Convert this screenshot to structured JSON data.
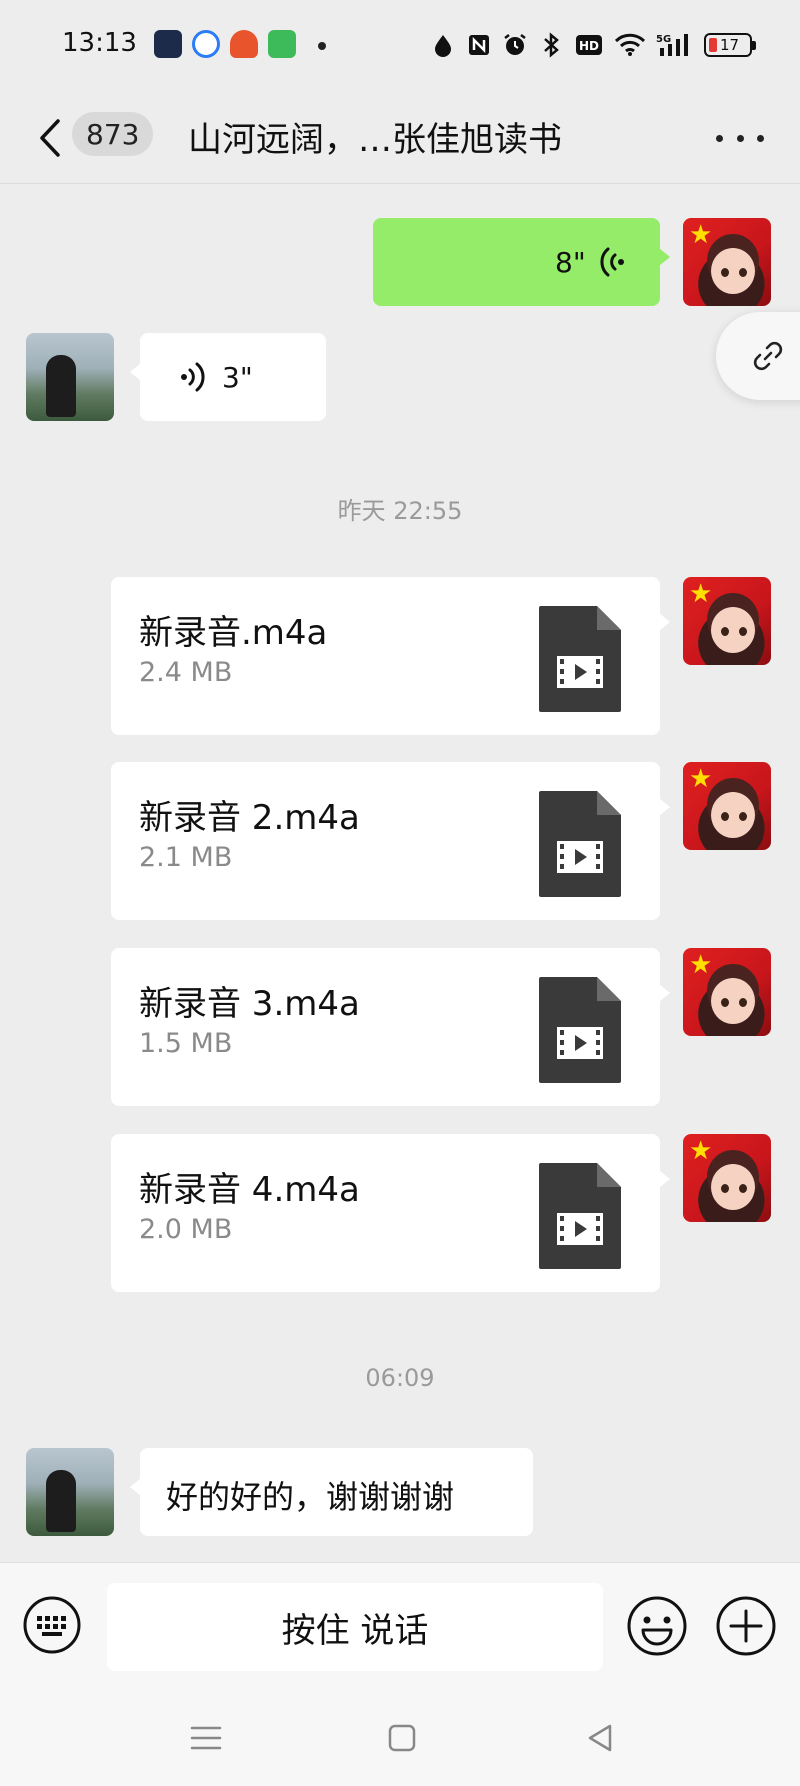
{
  "status_bar": {
    "time": "13:13",
    "battery_level": "17",
    "network": "5G",
    "hd": "HD"
  },
  "header": {
    "unread_count": "873",
    "title": "山河远阔，…张佳旭读书"
  },
  "messages": {
    "voice_sent": {
      "duration": "8\""
    },
    "voice_received": {
      "duration": "3\""
    },
    "time_yesterday": "昨天 22:55",
    "files": [
      {
        "name": "新录音.m4a",
        "size": "2.4 MB"
      },
      {
        "name": "新录音 2.m4a",
        "size": "2.1 MB"
      },
      {
        "name": "新录音 3.m4a",
        "size": "1.5 MB"
      },
      {
        "name": "新录音 4.m4a",
        "size": "2.0 MB"
      }
    ],
    "time_today": "06:09",
    "text_received": "好的好的，谢谢谢谢"
  },
  "input_bar": {
    "hold_to_talk": "按住 说话"
  },
  "colors": {
    "background": "#ededed",
    "sent_bubble": "#95ec69",
    "received_bubble": "#ffffff",
    "file_icon": "#3a3a3a"
  }
}
